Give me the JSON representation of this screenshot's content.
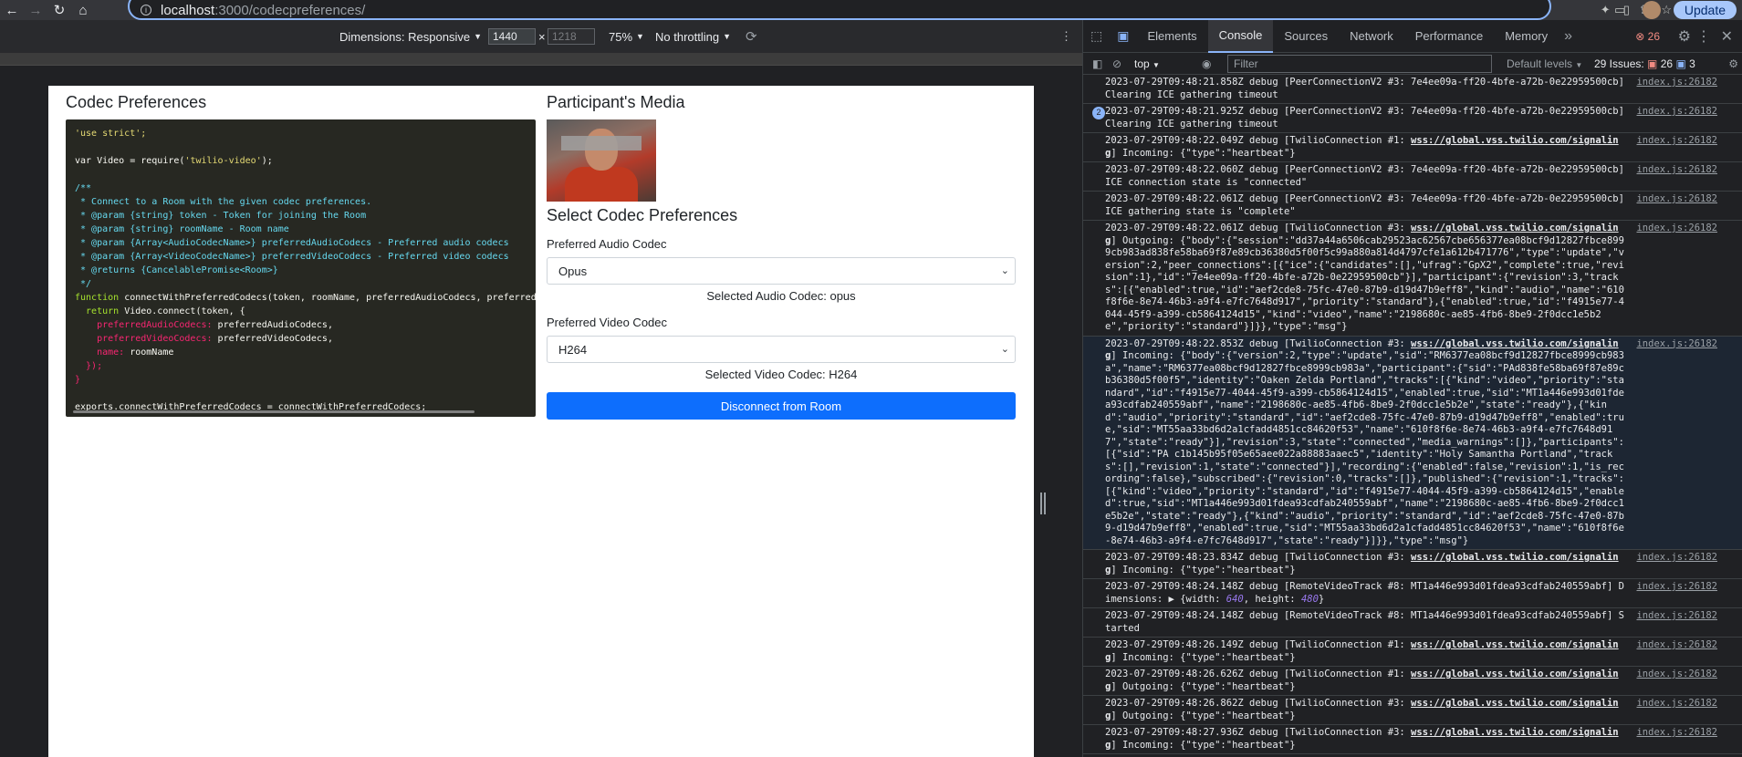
{
  "browser": {
    "url_host": "localhost",
    "url_path": ":3000/codecpreferences/",
    "update_label": "Update"
  },
  "device_toolbar": {
    "dimensions_label": "Dimensions: Responsive",
    "width_value": "1440",
    "height_placeholder": "1218",
    "times": "×",
    "zoom": "75%",
    "throttling": "No throttling"
  },
  "page": {
    "codec_title": "Codec Preferences",
    "media_title": "Participant's Media",
    "select_title": "Select Codec Preferences",
    "audio_label": "Preferred Audio Codec",
    "audio_value": "Opus",
    "audio_selected": "Selected Audio Codec: opus",
    "video_label": "Preferred Video Codec",
    "video_value": "H264",
    "video_selected": "Selected Video Codec: H264",
    "disconnect_label": "Disconnect from Room"
  },
  "code_lines": [
    [
      {
        "c": "c-str",
        "t": "'use strict';"
      }
    ],
    [],
    [
      {
        "c": "c-plain",
        "t": "var Video = require("
      },
      {
        "c": "c-str",
        "t": "'twilio-video'"
      },
      {
        "c": "c-plain",
        "t": ");"
      }
    ],
    [],
    [
      {
        "c": "c-cmt",
        "t": "/**"
      }
    ],
    [
      {
        "c": "c-cmt",
        "t": " * Connect to a Room with the given codec preferences."
      }
    ],
    [
      {
        "c": "c-cmt",
        "t": " * @param {string} token - Token for joining the Room"
      }
    ],
    [
      {
        "c": "c-cmt",
        "t": " * @param {string} roomName - Room name"
      }
    ],
    [
      {
        "c": "c-cmt",
        "t": " * @param {Array<AudioCodecName>} preferredAudioCodecs - Preferred audio codecs"
      }
    ],
    [
      {
        "c": "c-cmt",
        "t": " * @param {Array<VideoCodecName>} preferredVideoCodecs - Preferred video codecs"
      }
    ],
    [
      {
        "c": "c-cmt",
        "t": " * @returns {CancelablePromise<Room>}"
      }
    ],
    [
      {
        "c": "c-cmt",
        "t": " */"
      }
    ],
    [
      {
        "c": "c-kw",
        "t": "function "
      },
      {
        "c": "c-plain",
        "t": "connectWithPreferredCodecs(token, roomName, preferredAudioCodecs, preferredVideoCodecs) {"
      }
    ],
    [
      {
        "c": "c-kw",
        "t": "  return "
      },
      {
        "c": "c-plain",
        "t": "Video.connect(token, {"
      }
    ],
    [
      {
        "c": "c-red",
        "t": "    preferredAudioCodecs: "
      },
      {
        "c": "c-plain",
        "t": "preferredAudioCodecs,"
      }
    ],
    [
      {
        "c": "c-red",
        "t": "    preferredVideoCodecs: "
      },
      {
        "c": "c-plain",
        "t": "preferredVideoCodecs,"
      }
    ],
    [
      {
        "c": "c-red",
        "t": "    name: "
      },
      {
        "c": "c-plain",
        "t": "roomName"
      }
    ],
    [
      {
        "c": "c-red",
        "t": "  });"
      }
    ],
    [
      {
        "c": "c-red",
        "t": "}"
      }
    ],
    [],
    [
      {
        "c": "c-plain",
        "t": "exports.connectWithPreferredCodecs = connectWithPreferredCodecs;"
      }
    ]
  ],
  "devtools": {
    "tabs": [
      "Elements",
      "Console",
      "Sources",
      "Network",
      "Performance",
      "Memory"
    ],
    "active_tab": "Console",
    "error_count": "26",
    "context": "top",
    "filter_placeholder": "Filter",
    "levels": "Default levels",
    "issues_label": "29 Issues:",
    "issues_errors": "26",
    "issues_info": "3"
  },
  "logs": [
    {
      "text": "2023-07-29T09:48:21.858Z debug [PeerConnectionV2 #3: 7e4ee09a-ff20-4bfe-a72b-0e22959500cb] Clearing ICE gathering timeout",
      "src": "index.js:26182"
    },
    {
      "badge": "2",
      "text": "2023-07-29T09:48:21.925Z debug [PeerConnectionV2 #3: 7e4ee09a-ff20-4bfe-a72b-0e22959500cb] Clearing ICE gathering timeout",
      "src": "index.js:26182"
    },
    {
      "pre": "2023-07-29T09:48:22.049Z debug [TwilioConnection #1: ",
      "link": "wss://global.vss.twilio.com/signaling",
      "post": "] Incoming: {\"type\":\"heartbeat\"}",
      "src": "index.js:26182"
    },
    {
      "text": "2023-07-29T09:48:22.060Z debug [PeerConnectionV2 #3: 7e4ee09a-ff20-4bfe-a72b-0e22959500cb] ICE connection state is \"connected\"",
      "src": "index.js:26182"
    },
    {
      "text": "2023-07-29T09:48:22.061Z debug [PeerConnectionV2 #3: 7e4ee09a-ff20-4bfe-a72b-0e22959500cb] ICE gathering state is \"complete\"",
      "src": "index.js:26182"
    },
    {
      "pre": "2023-07-29T09:48:22.061Z debug [TwilioConnection #3: ",
      "link": "wss://global.vss.twilio.com/signaling",
      "post": "] Outgoing: {\"body\":{\"session\":\"dd37a44a6506cab29523ac62567cbe656377ea08bcf9d12827fbce8999cb983ad838fe58ba69f87e89cb36380d5f00f5c99a880a814d4797cfe1a612b471776\",\"type\":\"update\",\"version\":2,\"peer_connections\":[{\"ice\":{\"candidates\":[],\"ufrag\":\"GpX2\",\"complete\":true,\"revision\":1},\"id\":\"7e4ee09a-ff20-4bfe-a72b-0e22959500cb\"}],\"participant\":{\"revision\":3,\"tracks\":[{\"enabled\":true,\"id\":\"aef2cde8-75fc-47e0-87b9-d19d47b9eff8\",\"kind\":\"audio\",\"name\":\"610f8f6e-8e74-46b3-a9f4-e7fc7648d917\",\"priority\":\"standard\"},{\"enabled\":true,\"id\":\"f4915e77-4044-45f9-a399-cb5864124d15\",\"kind\":\"video\",\"name\":\"2198680c-ae85-4fb6-8be9-2f0dcc1e5b2e\",\"priority\":\"standard\"}]}},\"type\":\"msg\"}",
      "src": "index.js:26182"
    },
    {
      "selected": true,
      "pre": "2023-07-29T09:48:22.853Z debug [TwilioConnection #3: ",
      "link": "wss://global.vss.twilio.com/signaling",
      "post": "] Incoming: {\"body\":{\"version\":2,\"type\":\"update\",\"sid\":\"RM6377ea08bcf9d12827fbce8999cb983a\",\"name\":\"RM6377ea08bcf9d12827fbce8999cb983a\",\"participant\":{\"sid\":\"PAd838fe58ba69f87e89cb36380d5f00f5\",\"identity\":\"Oaken Zelda Portland\",\"tracks\":[{\"kind\":\"video\",\"priority\":\"standard\",\"id\":\"f4915e77-4044-45f9-a399-cb5864124d15\",\"enabled\":true,\"sid\":\"MT1a446e993d01fdea93cdfab240559abf\",\"name\":\"2198680c-ae85-4fb6-8be9-2f0dcc1e5b2e\",\"state\":\"ready\"},{\"kind\":\"audio\",\"priority\":\"standard\",\"id\":\"aef2cde8-75fc-47e0-87b9-d19d47b9eff8\",\"enabled\":true,\"sid\":\"MT55aa33bd6d2a1cfadd4851cc84620f53\",\"name\":\"610f8f6e-8e74-46b3-a9f4-e7fc7648d917\",\"state\":\"ready\"}],\"revision\":3,\"state\":\"connected\",\"media_warnings\":[]},\"participants\":[{\"sid\":\"PA c1b145b95f05e65aee022a88883aaec5\",\"identity\":\"Holy Samantha Portland\",\"tracks\":[],\"revision\":1,\"state\":\"connected\"}],\"recording\":{\"enabled\":false,\"revision\":1,\"is_recording\":false},\"subscribed\":{\"revision\":0,\"tracks\":[]},\"published\":{\"revision\":1,\"tracks\":[{\"kind\":\"video\",\"priority\":\"standard\",\"id\":\"f4915e77-4044-45f9-a399-cb5864124d15\",\"enabled\":true,\"sid\":\"MT1a446e993d01fdea93cdfab240559abf\",\"name\":\"2198680c-ae85-4fb6-8be9-2f0dcc1e5b2e\",\"state\":\"ready\"},{\"kind\":\"audio\",\"priority\":\"standard\",\"id\":\"aef2cde8-75fc-47e0-87b9-d19d47b9eff8\",\"enabled\":true,\"sid\":\"MT55aa33bd6d2a1cfadd4851cc84620f53\",\"name\":\"610f8f6e-8e74-46b3-a9f4-e7fc7648d917\",\"state\":\"ready\"}]}},\"type\":\"msg\"}",
      "src": "index.js:26182"
    },
    {
      "pre": "2023-07-29T09:48:23.834Z debug [TwilioConnection #3: ",
      "link": "wss://global.vss.twilio.com/signaling",
      "post": "] Incoming: {\"type\":\"heartbeat\"}",
      "src": "index.js:26182"
    },
    {
      "text": "2023-07-29T09:48:24.148Z debug [RemoteVideoTrack #8: MT1a446e993d01fdea93cdfab240559abf] Dimensions: ",
      "obj": true,
      "src": "index.js:26182"
    },
    {
      "text": "2023-07-29T09:48:24.148Z debug [RemoteVideoTrack #8: MT1a446e993d01fdea93cdfab240559abf] Started",
      "src": "index.js:26182"
    },
    {
      "pre": "2023-07-29T09:48:26.149Z debug [TwilioConnection #1: ",
      "link": "wss://global.vss.twilio.com/signaling",
      "post": "] Incoming: {\"type\":\"heartbeat\"}",
      "src": "index.js:26182"
    },
    {
      "pre": "2023-07-29T09:48:26.626Z debug [TwilioConnection #1: ",
      "link": "wss://global.vss.twilio.com/signaling",
      "post": "] Outgoing: {\"type\":\"heartbeat\"}",
      "src": "index.js:26182"
    },
    {
      "pre": "2023-07-29T09:48:26.862Z debug [TwilioConnection #3: ",
      "link": "wss://global.vss.twilio.com/signaling",
      "post": "] Outgoing: {\"type\":\"heartbeat\"}",
      "src": "index.js:26182"
    },
    {
      "pre": "2023-07-29T09:48:27.936Z debug [TwilioConnection #3: ",
      "link": "wss://global.vss.twilio.com/signaling",
      "post": "] Incoming: {\"type\":\"heartbeat\"}",
      "src": "index.js:26182"
    }
  ],
  "dims_obj": {
    "width": "640",
    "height": "480"
  }
}
